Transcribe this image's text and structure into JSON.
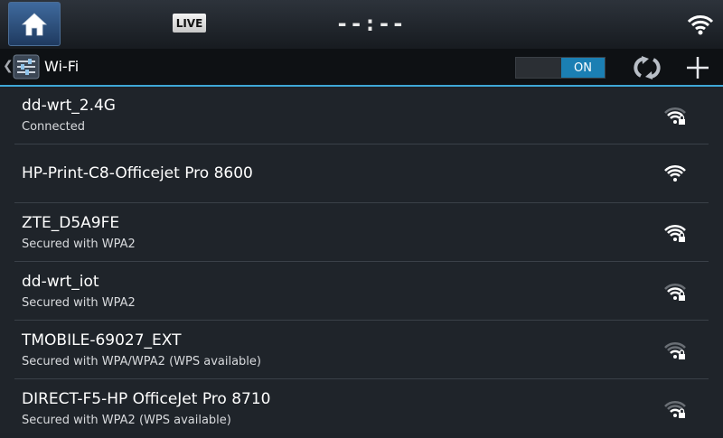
{
  "statusbar": {
    "live_label": "LIVE",
    "clock_text": "--:--"
  },
  "titlebar": {
    "title": "Wi-Fi",
    "toggle_label": "ON",
    "toggle_state": "on"
  },
  "networks": [
    {
      "name": "dd-wrt_2.4G",
      "status": "Connected",
      "signal": 0.8,
      "secured": true
    },
    {
      "name": "HP-Print-C8-Officejet Pro 8600",
      "status": "",
      "signal": 1.0,
      "secured": false
    },
    {
      "name": "ZTE_D5A9FE",
      "status": "Secured with WPA2",
      "signal": 1.0,
      "secured": true
    },
    {
      "name": "dd-wrt_iot",
      "status": "Secured with WPA2",
      "signal": 0.75,
      "secured": true
    },
    {
      "name": "TMOBILE-69027_EXT",
      "status": "Secured with WPA/WPA2 (WPS available)",
      "signal": 0.5,
      "secured": true
    },
    {
      "name": "DIRECT-F5-HP OfficeJet Pro 8710",
      "status": "Secured with WPA2 (WPS available)",
      "signal": 0.5,
      "secured": true
    }
  ],
  "colors": {
    "accent": "#3fa7d6",
    "toggle_on": "#1b7fb3",
    "list_bg": "#1f242a",
    "divider": "#3a4048"
  },
  "icons": {
    "home": "home-icon",
    "status_wifi": "wifi-icon",
    "settings": "settings-icon",
    "scan": "refresh-icon",
    "add": "plus-icon",
    "back": "chevron-left-icon",
    "network_signal": "wifi-signal-icon",
    "lock": "lock-icon"
  }
}
